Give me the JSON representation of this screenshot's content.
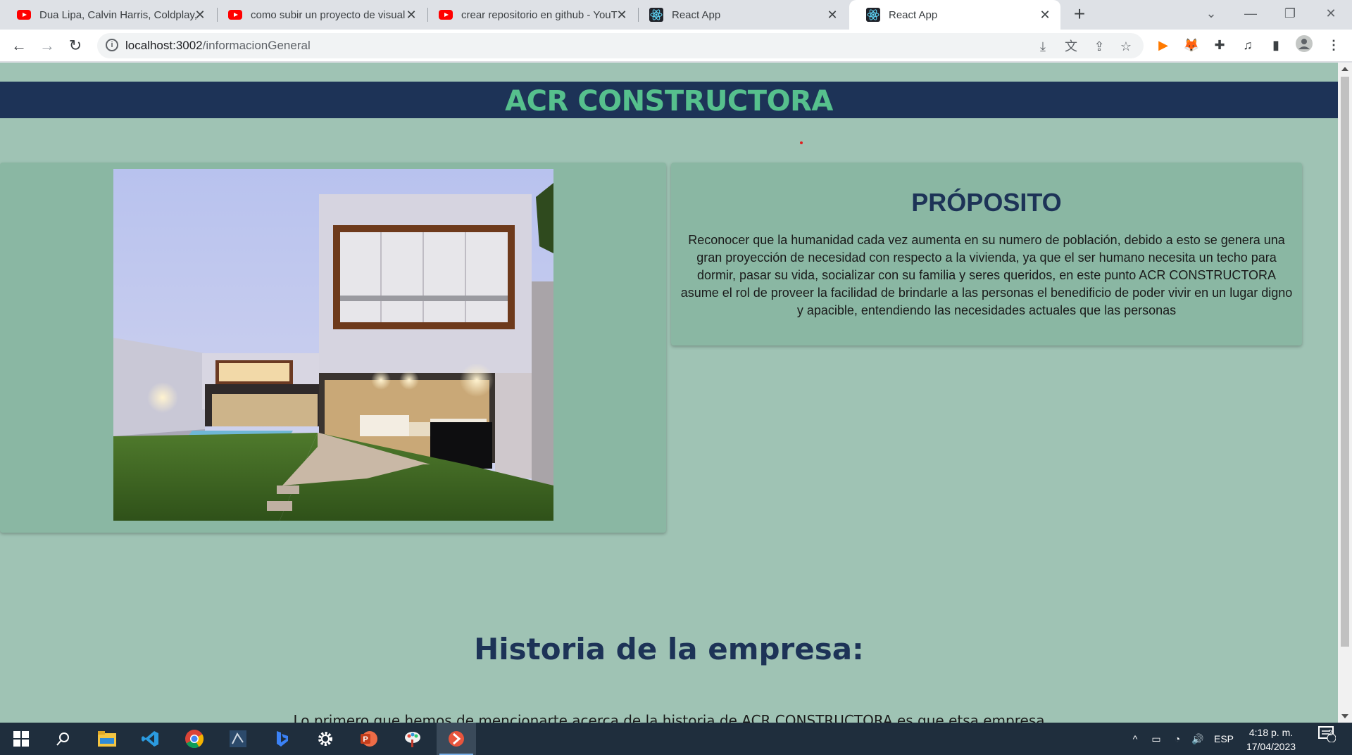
{
  "browser": {
    "tabs": [
      {
        "title": "Dua Lipa, Calvin Harris, Coldplay,",
        "favicon": "youtube-icon"
      },
      {
        "title": "como subir un proyecto de visual",
        "favicon": "youtube-icon"
      },
      {
        "title": "crear repositorio en github - YouT",
        "favicon": "youtube-icon"
      },
      {
        "title": "React App",
        "favicon": "react-icon"
      },
      {
        "title": "React App",
        "favicon": "react-icon",
        "active": true
      }
    ],
    "url_host": "localhost:3002",
    "url_path": "/informacionGeneral"
  },
  "page": {
    "brand": "ACR CONSTRUCTORA",
    "purpose_title": "PRÓPOSITO",
    "purpose_text": "Reconocer que la humanidad cada vez aumenta en su numero de población, debido a esto se genera una gran proyección de necesidad con respecto a la vivienda, ya que el ser humano necesita un techo para dormir, pasar su vida, socializar con su familia y seres queridos, en este punto ACR CONSTRUCTORA asume el rol de proveer la facilidad de brindarle a las personas el benedificio de poder vivir en un lugar digno y apacible, entendiendo las necesidades actuales que las personas",
    "history_title": "Historia de la empresa:",
    "history_text": "Lo primero que hemos de mencionarte acerca de la historia de ACR CONSTRUCTORA es que etsa empresa"
  },
  "taskbar": {
    "lang": "ESP",
    "time": "4:18 p. m.",
    "date": "17/04/2023",
    "notifications": "2"
  },
  "colors": {
    "header_bg": "#1d3357",
    "brand_green": "#56c08d",
    "page_bg": "#9fc3b4",
    "card_bg": "#8ab7a3"
  }
}
